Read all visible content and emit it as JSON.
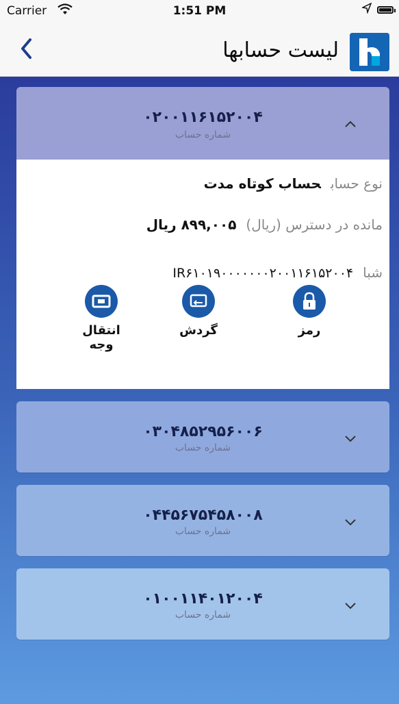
{
  "status_bar": {
    "carrier": "Carrier",
    "time": "1:51 PM"
  },
  "nav": {
    "title": "لیست حسابها"
  },
  "accounts": [
    {
      "number": "۰۲۰۰۱۱۶۱۵۲۰۰۴",
      "caption": "شماره حساب",
      "expanded": true
    },
    {
      "number": "۰۳۰۴۸۵۲۹۵۶۰۰۶",
      "caption": "شماره حساب",
      "expanded": false
    },
    {
      "number": "۰۴۴۵۶۷۵۴۵۸۰۰۸",
      "caption": "شماره حساب",
      "expanded": false
    },
    {
      "number": "۰۱۰۰۱۱۴۰۱۲۰۰۴",
      "caption": "شماره حساب",
      "expanded": false
    }
  ],
  "details": {
    "type_label": "نوع حساب",
    "type_value": "حساب کوتاه مدت",
    "balance_label": "مانده در دسترس (ریال)",
    "balance_value": "۸۹۹,۰۰۵ ریال",
    "sheba_label": "شبا",
    "sheba_value": "IR۶۱۰۱۹۰۰۰۰۰۰۰۲۰۰۱۱۶۱۵۲۰۰۴"
  },
  "actions": {
    "transfer": "انتقال وجه",
    "turnover": "گردش",
    "password": "رمز"
  },
  "colors": {
    "brand": "#1565b5",
    "action_blue": "#1a5aa8",
    "header_1": "#9aa0d4",
    "header_2": "#8fa9df",
    "header_3": "#94b3e3",
    "header_4": "#a3c4ea"
  }
}
